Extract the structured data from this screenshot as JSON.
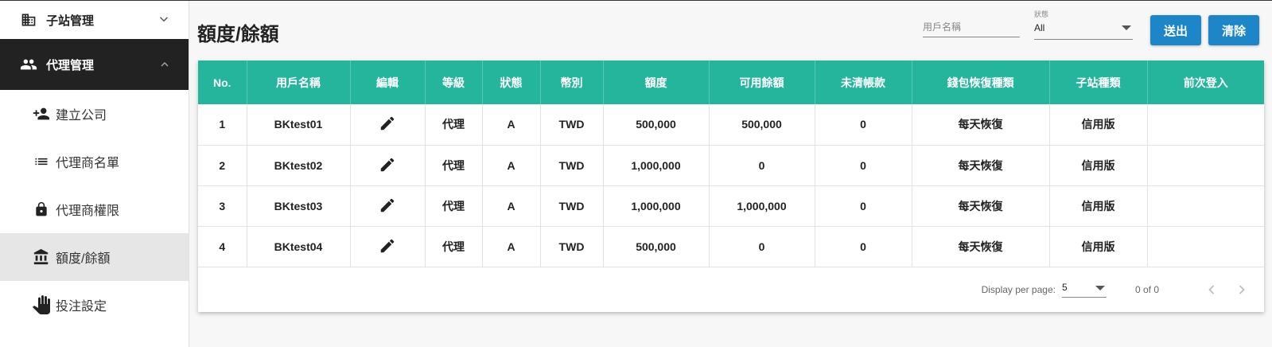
{
  "sidebar": {
    "top_item": {
      "label": "子站管理",
      "icon": "building-icon"
    },
    "section": {
      "label": "代理管理",
      "icon": "people-icon"
    },
    "items": [
      {
        "label": "建立公司",
        "icon": "person-add-icon"
      },
      {
        "label": "代理商名單",
        "icon": "list-icon"
      },
      {
        "label": "代理商權限",
        "icon": "lock-icon"
      },
      {
        "label": "額度/餘額",
        "icon": "bank-icon"
      },
      {
        "label": "投注設定",
        "icon": "hand-icon"
      }
    ]
  },
  "header": {
    "title": "額度/餘額",
    "username_placeholder": "用戶名稱",
    "status_caption": "狀態",
    "status_value": "All",
    "submit_label": "送出",
    "clear_label": "清除"
  },
  "table": {
    "columns": [
      "No.",
      "用戶名稱",
      "編輯",
      "等級",
      "狀態",
      "幣別",
      "額度",
      "可用餘額",
      "未清帳款",
      "錢包恢復種類",
      "子站種類",
      "前次登入"
    ],
    "rows": [
      {
        "no": "1",
        "user": "BKtest01",
        "level": "代理",
        "status": "A",
        "currency": "TWD",
        "credit": "500,000",
        "available": "500,000",
        "outstanding": "0",
        "wallet": "每天恢復",
        "site_type": "信用版",
        "last_login": ""
      },
      {
        "no": "2",
        "user": "BKtest02",
        "level": "代理",
        "status": "A",
        "currency": "TWD",
        "credit": "1,000,000",
        "available": "0",
        "outstanding": "0",
        "wallet": "每天恢復",
        "site_type": "信用版",
        "last_login": ""
      },
      {
        "no": "3",
        "user": "BKtest03",
        "level": "代理",
        "status": "A",
        "currency": "TWD",
        "credit": "1,000,000",
        "available": "1,000,000",
        "outstanding": "0",
        "wallet": "每天恢復",
        "site_type": "信用版",
        "last_login": ""
      },
      {
        "no": "4",
        "user": "BKtest04",
        "level": "代理",
        "status": "A",
        "currency": "TWD",
        "credit": "500,000",
        "available": "0",
        "outstanding": "0",
        "wallet": "每天恢復",
        "site_type": "信用版",
        "last_login": ""
      }
    ]
  },
  "pager": {
    "per_page_label": "Display per page:",
    "per_page_value": "5",
    "range": "0 of 0"
  },
  "colors": {
    "header_teal": "#24b59c",
    "button_blue": "#1c86c8",
    "sidebar_active": "#222222"
  }
}
